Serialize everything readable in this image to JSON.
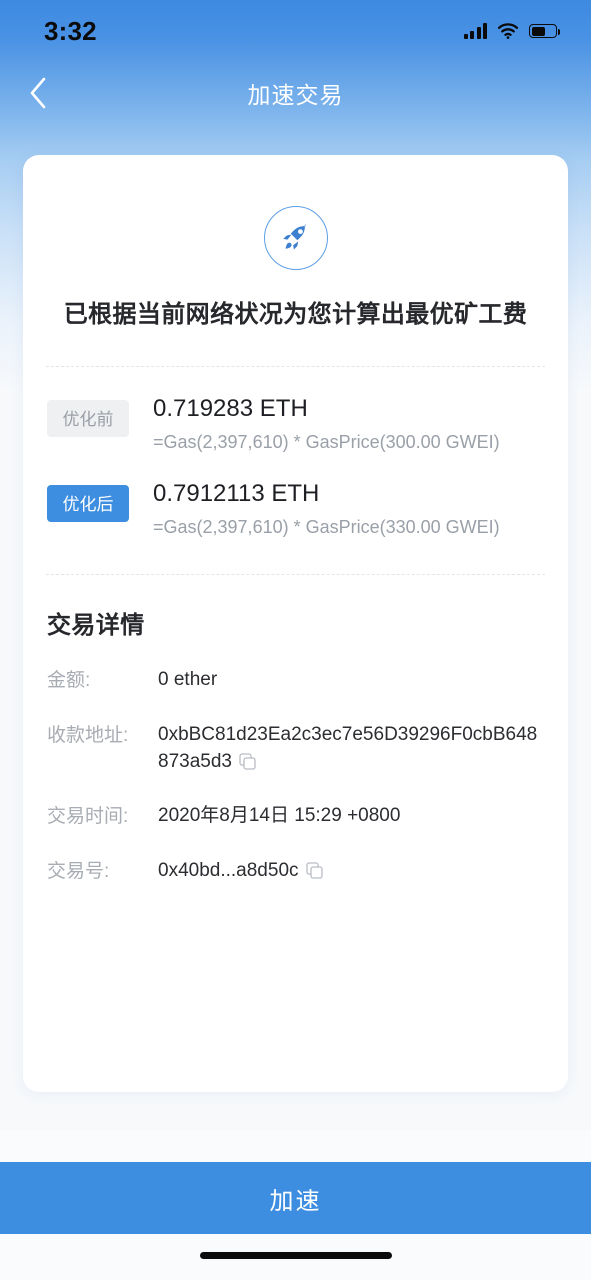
{
  "status_bar": {
    "time": "3:32",
    "signal_icon": "signal-bars-icon",
    "wifi_icon": "wifi-icon",
    "battery_icon": "battery-icon"
  },
  "nav": {
    "back_icon": "chevron-left-icon",
    "title": "加速交易"
  },
  "card": {
    "hero_icon": "rocket-icon",
    "headline": "已根据当前网络状况为您计算出最优矿工费",
    "gas_rows": [
      {
        "badge": "优化前",
        "amount": "0.719283 ETH",
        "formula": "=Gas(2,397,610) * GasPrice(300.00 GWEI)",
        "gas_limit": "2,397,610",
        "gas_price": "300.00 GWEI"
      },
      {
        "badge": "优化后",
        "amount": "0.7912113 ETH",
        "formula": "=Gas(2,397,610) * GasPrice(330.00 GWEI)",
        "gas_limit": "2,397,610",
        "gas_price": "330.00 GWEI"
      }
    ],
    "details": {
      "title": "交易详情",
      "rows": [
        {
          "label": "金额:",
          "value": "0 ether",
          "copyable": false
        },
        {
          "label": "收款地址:",
          "value": "0xbBC81d23Ea2c3ec7e56D39296F0cbB648873a5d3",
          "copyable": true
        },
        {
          "label": "交易时间:",
          "value": "2020年8月14日 15:29 +0800",
          "copyable": false
        },
        {
          "label": "交易号:",
          "value": "0x40bd...a8d50c",
          "copyable": true
        }
      ],
      "copy_icon": "copy-icon"
    }
  },
  "bottom": {
    "action_label": "加速"
  },
  "colors": {
    "accent": "#3d8ee0",
    "badge_before_bg": "#eef0f2",
    "badge_before_text": "#9a9ea6",
    "badge_after_bg": "#3d8ee0",
    "page_bg": "#f7f9fb",
    "card_bg": "#ffffff",
    "label_text": "#a8acb3",
    "value_text": "#2b2d31",
    "muted_text": "#9aa0a8"
  }
}
